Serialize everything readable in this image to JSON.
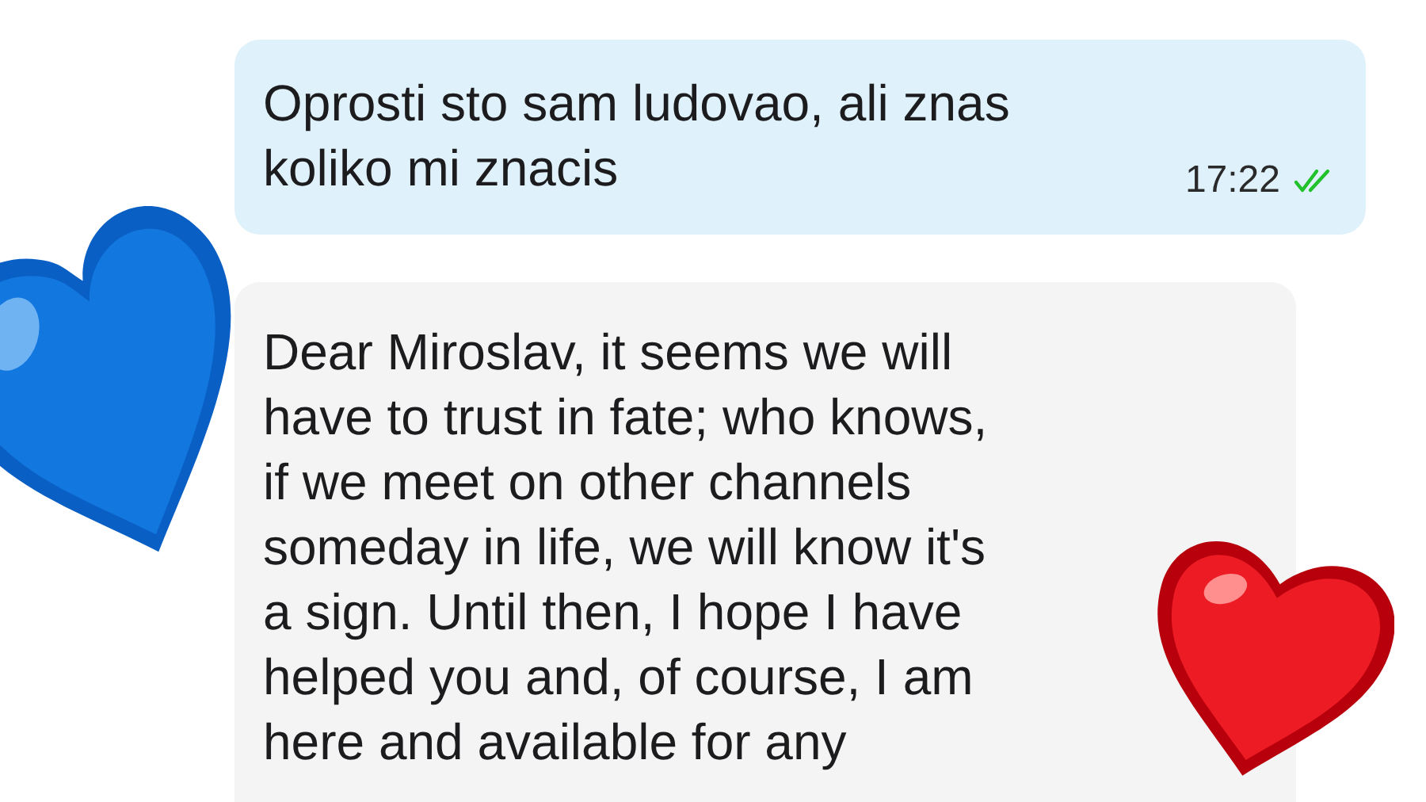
{
  "messages": [
    {
      "kind": "outgoing",
      "text": "Oprosti sto sam ludovao, ali znas\nkoliko mi znacis",
      "time": "17:22",
      "read": true
    },
    {
      "kind": "incoming",
      "text": "Dear Miroslav, it seems we will\nhave to trust in fate; who knows,\nif we meet on other channels\nsomeday in life, we will know it's\na sign. Until then, I hope I have\nhelped you and, of course, I am\nhere and available for any"
    }
  ]
}
